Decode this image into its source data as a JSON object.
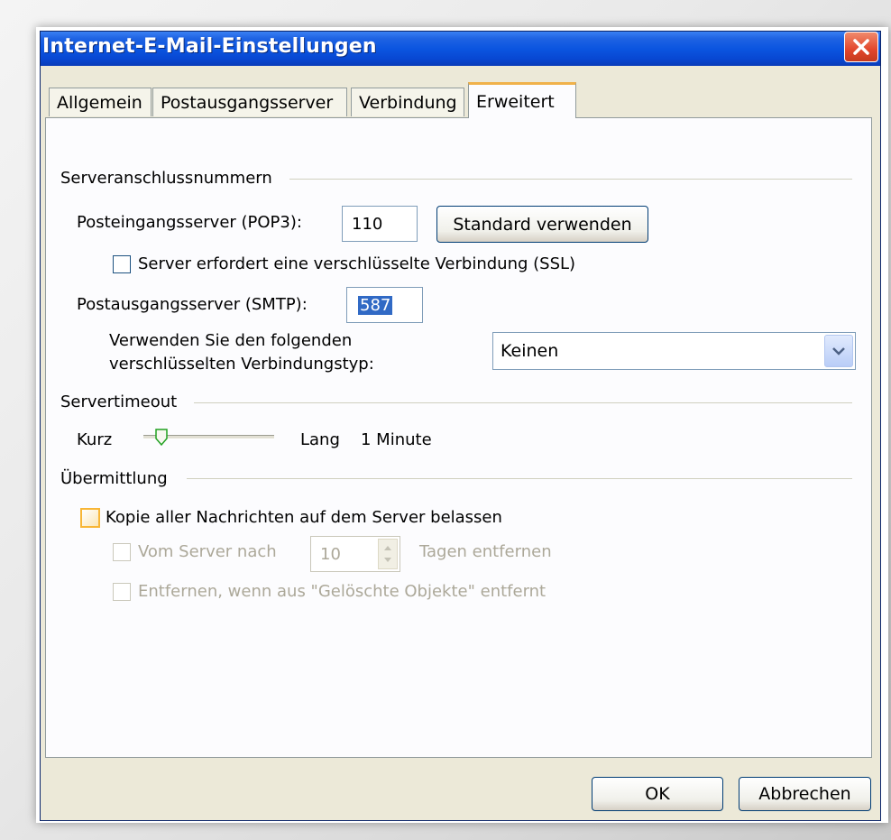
{
  "window": {
    "title": "Internet-E-Mail-Einstellungen"
  },
  "tabs": [
    {
      "label": "Allgemein",
      "active": false
    },
    {
      "label": "Postausgangsserver",
      "active": false
    },
    {
      "label": "Verbindung",
      "active": false
    },
    {
      "label": "Erweitert",
      "active": true
    }
  ],
  "ports": {
    "section_label": "Serveranschlussnummern",
    "pop3_label": "Posteingangsserver (POP3):",
    "pop3_value": "110",
    "default_button": "Standard verwenden",
    "ssl_label": "Server erfordert eine verschlüsselte Verbindung (SSL)",
    "ssl_checked": false,
    "smtp_label": "Postausgangsserver (SMTP):",
    "smtp_value": "587",
    "enc_label_line1": "Verwenden Sie den folgenden",
    "enc_label_line2": "verschlüsselten Verbindungstyp:",
    "enc_value": "Keinen"
  },
  "timeout": {
    "section_label": "Servertimeout",
    "short_label": "Kurz",
    "long_label": "Lang",
    "value_text": "1 Minute",
    "slider_level": 0.1
  },
  "delivery": {
    "section_label": "Übermittlung",
    "keep_copy_label": "Kopie aller Nachrichten auf dem Server belassen",
    "keep_copy_checked": false,
    "remove_after_label": "Vom Server nach",
    "remove_days": "10",
    "remove_after_suffix": "Tagen entfernen",
    "remove_deleted_label": "Entfernen, wenn aus \"Gelöschte Objekte\" entfernt"
  },
  "footer": {
    "ok": "OK",
    "cancel": "Abbrechen"
  },
  "colors": {
    "titlebar": "#0b55e0",
    "dialog_bg": "#ece9d8",
    "tab_active_accent": "#f0b24a",
    "selection": "#316ac5"
  }
}
